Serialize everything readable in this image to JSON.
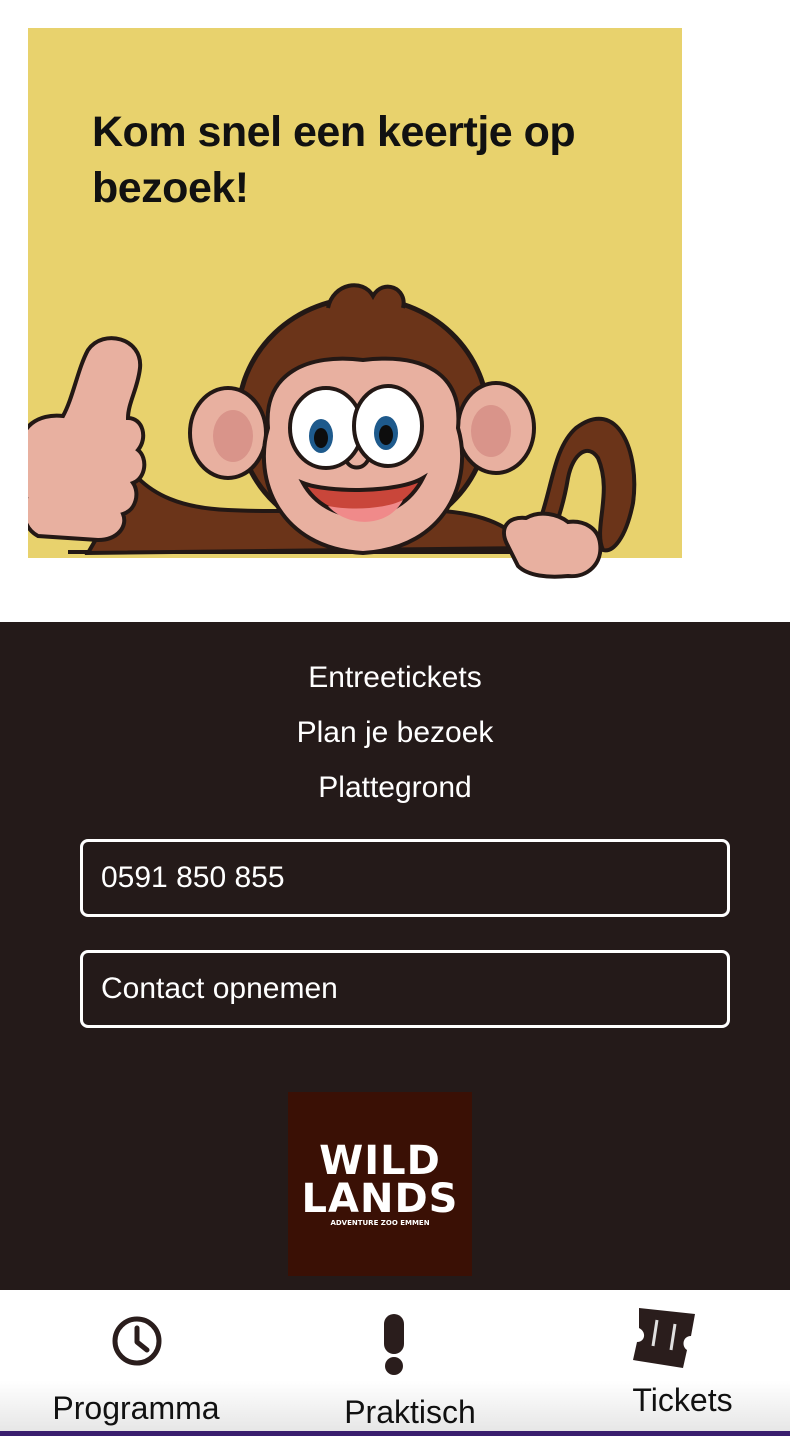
{
  "promo": {
    "title": "Kom snel een keertje op bezoek!",
    "background_color": "#e8d26d",
    "image": "cartoon-monkey-thumbs-up"
  },
  "footer": {
    "background_color": "#241a19",
    "links": [
      "Entreetickets",
      "Plan je bezoek",
      "Plattegrond"
    ],
    "phone_button": "0591 850 855",
    "contact_button": "Contact opnemen",
    "logo": {
      "line1": "WILD",
      "line2": "LANDS",
      "tagline": "ADVENTURE ZOO EMMEN",
      "background_color": "#3a1005"
    }
  },
  "tabbar": {
    "tabs": [
      {
        "label": "Programma",
        "icon": "clock-icon"
      },
      {
        "label": "Praktisch",
        "icon": "exclamation-icon"
      },
      {
        "label": "Tickets",
        "icon": "ticket-icon"
      }
    ]
  }
}
